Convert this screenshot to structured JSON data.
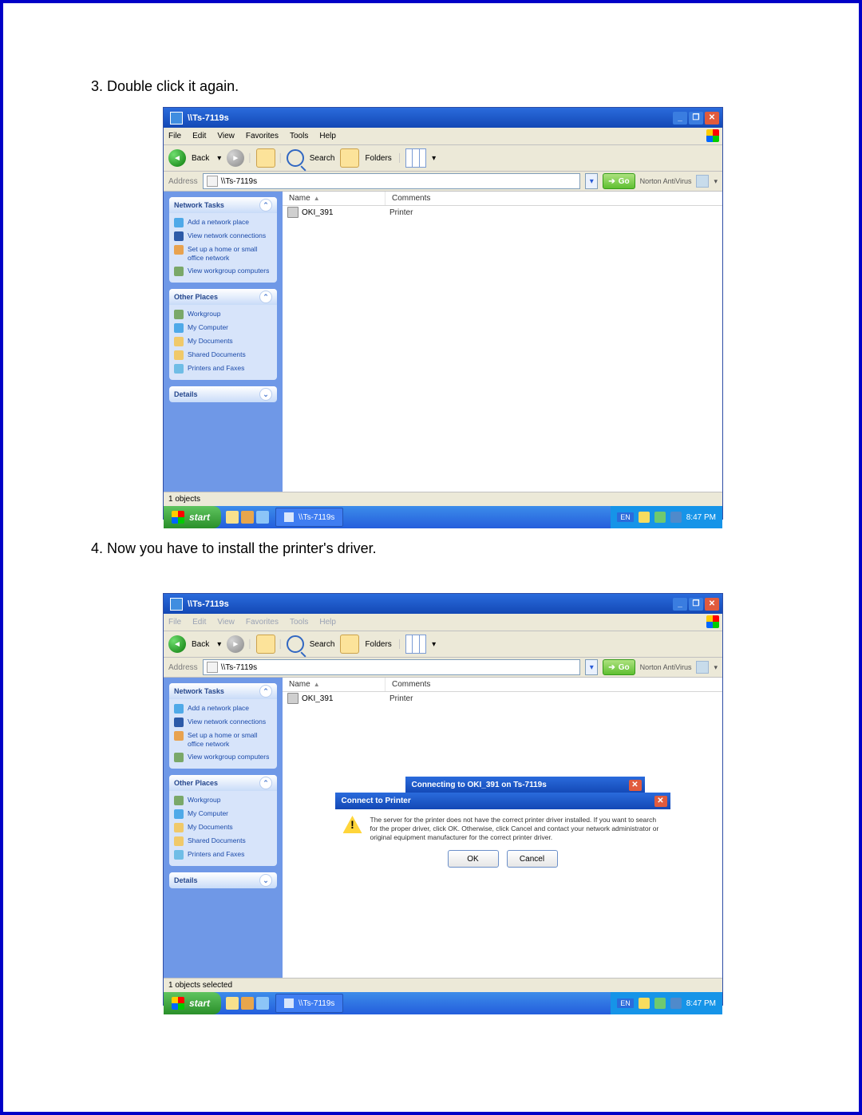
{
  "step3": "3. Double click it again.",
  "step4": "4. Now you have to install the printer's driver.",
  "window": {
    "title": "\\\\Ts-7119s",
    "minimize": "_",
    "maximize": "❐",
    "close": "✕"
  },
  "menu": {
    "file": "File",
    "edit": "Edit",
    "view": "View",
    "favorites": "Favorites",
    "tools": "Tools",
    "help": "Help"
  },
  "toolbar": {
    "back": "Back",
    "back_arrow": "▾",
    "search": "Search",
    "folders": "Folders"
  },
  "address": {
    "label": "Address",
    "value": "\\\\Ts-7119s",
    "drop": "▾",
    "go": "Go",
    "norton": "Norton AntiVirus",
    "norton_drop": "▾"
  },
  "columns": {
    "name": "Name",
    "sort": "▲",
    "comments": "Comments"
  },
  "item": {
    "name": "OKI_391",
    "type": "Printer"
  },
  "panels": {
    "network": {
      "title": "Network Tasks",
      "chev": "⌃",
      "items": [
        {
          "icon": "#4fa9e8",
          "text": "Add a network place"
        },
        {
          "icon": "#2c5aa8",
          "text": "View network connections"
        },
        {
          "icon": "#e8a24f",
          "text": "Set up a home or small office network"
        },
        {
          "icon": "#7aa869",
          "text": "View workgroup computers"
        }
      ]
    },
    "other": {
      "title": "Other Places",
      "chev": "⌃",
      "items": [
        {
          "icon": "#7aa869",
          "text": "Workgroup"
        },
        {
          "icon": "#4fa9e8",
          "text": "My Computer"
        },
        {
          "icon": "#f0c96a",
          "text": "My Documents"
        },
        {
          "icon": "#f0c96a",
          "text": "Shared Documents"
        },
        {
          "icon": "#6fbde6",
          "text": "Printers and Faxes"
        }
      ]
    },
    "details": {
      "title": "Details",
      "chev": "⌄"
    }
  },
  "status1": "1 objects",
  "status2": "1 objects selected",
  "taskbar": {
    "start": "start",
    "task": "\\\\Ts-7119s",
    "lang": "EN",
    "time": "8:47 PM"
  },
  "dialog": {
    "progress_title": "Connecting to OKI_391 on Ts-7119s",
    "connect_title": "Connect to Printer",
    "message": "The server for the printer does not have the correct printer driver installed. If you want to search for the proper driver, click OK. Otherwise, click Cancel and contact your network administrator or original equipment manufacturer for the correct printer driver.",
    "ok": "OK",
    "cancel": "Cancel",
    "close": "✕"
  }
}
